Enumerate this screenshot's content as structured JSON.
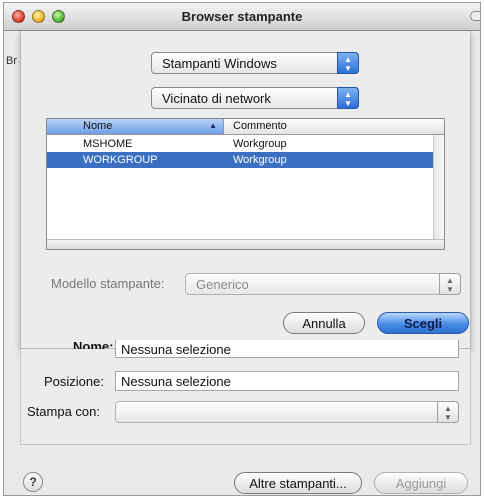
{
  "window": {
    "title": "Browser stampante"
  },
  "background": {
    "peek_label": "Br"
  },
  "sheet": {
    "protocol_popup": {
      "value": "Stampanti Windows"
    },
    "scope_popup": {
      "value": "Vicinato di network"
    },
    "list": {
      "columns": [
        "Nome",
        "Commento"
      ],
      "rows": [
        {
          "name": "MSHOME",
          "comment": "Workgroup",
          "selected": false
        },
        {
          "name": "WORKGROUP",
          "comment": "Workgroup",
          "selected": true
        }
      ]
    },
    "model_label": "Modello stampante:",
    "model_popup": {
      "value": "Generico"
    },
    "cancel_label": "Annulla",
    "choose_label": "Scegli"
  },
  "lower": {
    "name_label": "Nome:",
    "name_value": "Nessuna selezione",
    "position_label": "Posizione:",
    "position_value": "Nessuna selezione",
    "print_with_label": "Stampa con:",
    "print_with_value": ""
  },
  "footer": {
    "help_label": "?",
    "more_printers_label": "Altre stampanti...",
    "add_label": "Aggiungi"
  },
  "colors": {
    "selection": "#3a6fc2",
    "accent": "#2f6fcf"
  }
}
